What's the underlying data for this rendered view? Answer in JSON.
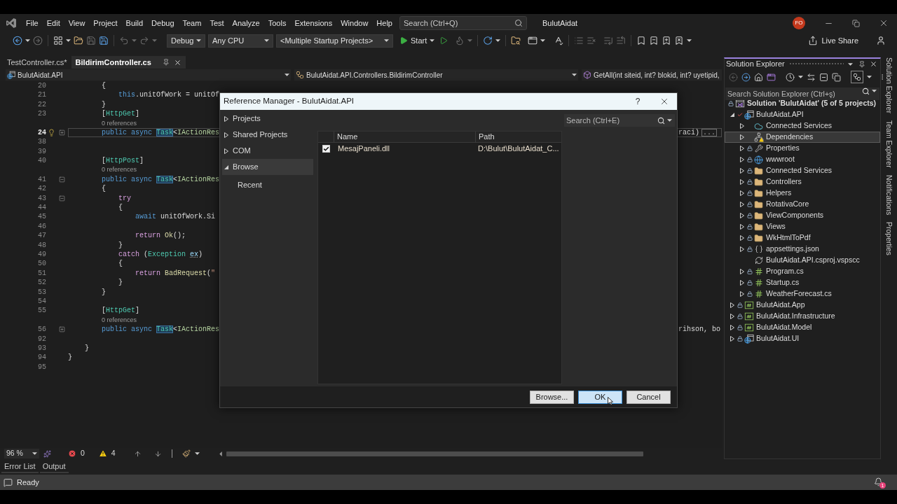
{
  "menu_bar": {
    "items": [
      "File",
      "Edit",
      "View",
      "Project",
      "Build",
      "Debug",
      "Team",
      "Test",
      "Analyze",
      "Tools",
      "Extensions",
      "Window",
      "Help"
    ],
    "search": {
      "placeholder": "Search (Ctrl+Q)"
    },
    "solution_title": "BulutAidat",
    "account_initials": "FO"
  },
  "toolbar": {
    "configuration": "Debug",
    "platform": "Any CPU",
    "startup_projects": "<Multiple Startup Projects>",
    "start": "Start",
    "live_share": "Live Share"
  },
  "editor": {
    "tabs": [
      {
        "label": "TestController.cs*",
        "selected": false
      },
      {
        "label": "BildirimController.cs",
        "selected": true
      }
    ],
    "navigation": {
      "project": "BulutAidat.API",
      "type": "BulutAidat.API.Controllers.BildirimController",
      "member": "GetAll(int siteid, int? blokid, int? uyetipid,"
    },
    "lines": [
      {
        "kind": "code",
        "number": "20",
        "current": false,
        "lightbulb": false,
        "tokens": [
          {
            "kind": "plain",
            "text": "        {"
          }
        ]
      },
      {
        "kind": "code",
        "number": "21",
        "current": false,
        "lightbulb": false,
        "tokens": [
          {
            "kind": "keyword",
            "text": "            this"
          },
          {
            "kind": "plain",
            "text": ".unitOfWork = unitOf"
          }
        ]
      },
      {
        "kind": "code",
        "number": "22",
        "current": false,
        "lightbulb": false,
        "tokens": [
          {
            "kind": "plain",
            "text": "        }"
          }
        ]
      },
      {
        "kind": "code",
        "number": "23",
        "current": false,
        "lightbulb": false,
        "tokens": [
          {
            "kind": "plain",
            "text": "        ["
          },
          {
            "kind": "type",
            "text": "HttpGet"
          },
          {
            "kind": "plain",
            "text": "]"
          }
        ]
      },
      {
        "kind": "codelens",
        "text": "0 references"
      },
      {
        "kind": "code",
        "number": "24",
        "current": true,
        "lightbulb": true,
        "collapsed": true,
        "tokens": [
          {
            "kind": "keyword",
            "text": "        public async "
          },
          {
            "kind": "type-highlighted",
            "text": "Task"
          },
          {
            "kind": "plain",
            "text": "<"
          },
          {
            "kind": "interface",
            "text": "IActionRes"
          }
        ],
        "tail": "raci)",
        "collapsed_marker": "..."
      },
      {
        "kind": "code",
        "number": "38",
        "current": false,
        "lightbulb": false
      },
      {
        "kind": "code",
        "number": "39",
        "current": false,
        "lightbulb": false
      },
      {
        "kind": "code",
        "number": "40",
        "current": false,
        "lightbulb": false,
        "tokens": [
          {
            "kind": "plain",
            "text": "        ["
          },
          {
            "kind": "type",
            "text": "HttpPost"
          },
          {
            "kind": "plain",
            "text": "]"
          }
        ]
      },
      {
        "kind": "codelens",
        "text": "0 references"
      },
      {
        "kind": "code",
        "number": "41",
        "current": false,
        "lightbulb": false,
        "collapsed": false,
        "tokens": [
          {
            "kind": "keyword",
            "text": "        public async "
          },
          {
            "kind": "type-highlighted",
            "text": "Task"
          },
          {
            "kind": "plain",
            "text": "<"
          },
          {
            "kind": "interface",
            "text": "IActionRes"
          }
        ]
      },
      {
        "kind": "code",
        "number": "42",
        "current": false,
        "lightbulb": false,
        "tokens": [
          {
            "kind": "plain",
            "text": "        {"
          }
        ]
      },
      {
        "kind": "code",
        "number": "43",
        "current": false,
        "lightbulb": false,
        "collapsed": false,
        "tokens": [
          {
            "kind": "control",
            "text": "            try"
          }
        ]
      },
      {
        "kind": "code",
        "number": "44",
        "current": false,
        "lightbulb": false,
        "tokens": [
          {
            "kind": "plain",
            "text": "            {"
          }
        ]
      },
      {
        "kind": "code",
        "number": "45",
        "current": false,
        "lightbulb": false,
        "tokens": [
          {
            "kind": "keyword",
            "text": "                await"
          },
          {
            "kind": "plain",
            "text": " unitOfWork.Si"
          }
        ]
      },
      {
        "kind": "code",
        "number": "46",
        "current": false,
        "lightbulb": false
      },
      {
        "kind": "code",
        "number": "47",
        "current": false,
        "lightbulb": false,
        "tokens": [
          {
            "kind": "control",
            "text": "                return "
          },
          {
            "kind": "method",
            "text": "Ok"
          },
          {
            "kind": "plain",
            "text": "();"
          }
        ]
      },
      {
        "kind": "code",
        "number": "48",
        "current": false,
        "lightbulb": false,
        "tokens": [
          {
            "kind": "plain",
            "text": "            }"
          }
        ]
      },
      {
        "kind": "code",
        "number": "49",
        "current": false,
        "lightbulb": false,
        "tokens": [
          {
            "kind": "control",
            "text": "            catch"
          },
          {
            "kind": "plain",
            "text": " ("
          },
          {
            "kind": "type",
            "text": "Exception "
          },
          {
            "kind": "hint",
            "text": "ex"
          },
          {
            "kind": "plain",
            "text": ")"
          }
        ]
      },
      {
        "kind": "code",
        "number": "50",
        "current": false,
        "lightbulb": false,
        "tokens": [
          {
            "kind": "plain",
            "text": "            {"
          }
        ]
      },
      {
        "kind": "code",
        "number": "51",
        "current": false,
        "lightbulb": false,
        "tokens": [
          {
            "kind": "control",
            "text": "                return "
          },
          {
            "kind": "method",
            "text": "BadRequest"
          },
          {
            "kind": "plain",
            "text": "("
          },
          {
            "kind": "string",
            "text": "\""
          }
        ]
      },
      {
        "kind": "code",
        "number": "52",
        "current": false,
        "lightbulb": false,
        "tokens": [
          {
            "kind": "plain",
            "text": "            }"
          }
        ]
      },
      {
        "kind": "code",
        "number": "53",
        "current": false,
        "lightbulb": false,
        "tokens": [
          {
            "kind": "plain",
            "text": "        }"
          }
        ]
      },
      {
        "kind": "code",
        "number": "54",
        "current": false,
        "lightbulb": false
      },
      {
        "kind": "code",
        "number": "55",
        "current": false,
        "lightbulb": false,
        "tokens": [
          {
            "kind": "plain",
            "text": "        ["
          },
          {
            "kind": "type",
            "text": "HttpGet"
          },
          {
            "kind": "plain",
            "text": "]"
          }
        ]
      },
      {
        "kind": "codelens",
        "text": "0 references"
      },
      {
        "kind": "code",
        "number": "56",
        "current": false,
        "lightbulb": false,
        "collapsed": true,
        "tokens": [
          {
            "kind": "keyword",
            "text": "        public async "
          },
          {
            "kind": "type-highlighted",
            "text": "Task"
          },
          {
            "kind": "plain",
            "text": "<"
          },
          {
            "kind": "interface",
            "text": "IActionRes"
          }
        ],
        "tail": "rihson, bo"
      },
      {
        "kind": "code",
        "number": "92",
        "current": false,
        "lightbulb": false
      },
      {
        "kind": "code",
        "number": "93",
        "current": false,
        "lightbulb": false,
        "tokens": [
          {
            "kind": "plain",
            "text": "    }"
          }
        ]
      },
      {
        "kind": "code",
        "number": "94",
        "current": false,
        "lightbulb": false,
        "tokens": [
          {
            "kind": "plain",
            "text": "}"
          }
        ]
      },
      {
        "kind": "code",
        "number": "95",
        "current": false,
        "lightbulb": false
      }
    ],
    "status": {
      "zoom": "96 %",
      "errors": "0",
      "warnings": "4"
    }
  },
  "reference_manager": {
    "title": "Reference Manager - BulutAidat.API",
    "help": "?",
    "nav": [
      {
        "label": "Projects",
        "expanded": false,
        "selected": false
      },
      {
        "label": "Shared Projects",
        "expanded": false,
        "selected": false
      },
      {
        "label": "COM",
        "expanded": false,
        "selected": false
      },
      {
        "label": "Browse",
        "expanded": true,
        "selected": true,
        "children": [
          {
            "label": "Recent",
            "selected": false
          }
        ]
      }
    ],
    "search": {
      "placeholder": "Search (Ctrl+E)"
    },
    "columns": [
      "Name",
      "Path"
    ],
    "rows": [
      {
        "checked": true,
        "name": "MesajPaneli.dll",
        "path": "D:\\Bulut\\BulutAidat_C..."
      }
    ],
    "buttons": [
      {
        "label": "Browse...",
        "focused": false
      },
      {
        "label": "OK",
        "focused": true
      },
      {
        "label": "Cancel",
        "focused": false
      }
    ]
  },
  "solution_explorer": {
    "title": "Solution Explorer",
    "search": {
      "placeholder": "Search Solution Explorer (Ctrl+ş)"
    },
    "tree": [
      {
        "label": "Solution 'BulutAidat' (5 of 5 projects)",
        "kind": "solution",
        "locked": true,
        "checked_out": false,
        "selected": false,
        "children": [
          {
            "label": "BulutAidat.API",
            "kind": "web-project",
            "locked": false,
            "checked_out": true,
            "selected": false,
            "expanded": true,
            "children": [
              {
                "label": "Connected Services",
                "kind": "connected-services",
                "locked": false,
                "checked_out": false,
                "selected": false,
                "expanded": false
              },
              {
                "label": "Dependencies",
                "kind": "dependencies",
                "locked": false,
                "checked_out": false,
                "selected": true,
                "expanded": false
              },
              {
                "label": "Properties",
                "kind": "properties",
                "locked": true,
                "checked_out": false,
                "selected": false,
                "expanded": false
              },
              {
                "label": "wwwroot",
                "kind": "web-folder",
                "locked": true,
                "checked_out": false,
                "selected": false,
                "expanded": false
              },
              {
                "label": "Connected Services",
                "kind": "folder",
                "locked": true,
                "checked_out": false,
                "selected": false,
                "expanded": false
              },
              {
                "label": "Controllers",
                "kind": "folder",
                "locked": true,
                "checked_out": false,
                "selected": false,
                "expanded": false
              },
              {
                "label": "Helpers",
                "kind": "folder",
                "locked": true,
                "checked_out": false,
                "selected": false,
                "expanded": false
              },
              {
                "label": "RotativaCore",
                "kind": "folder",
                "locked": true,
                "checked_out": false,
                "selected": false,
                "expanded": false
              },
              {
                "label": "ViewComponents",
                "kind": "folder",
                "locked": true,
                "checked_out": false,
                "selected": false,
                "expanded": false
              },
              {
                "label": "Views",
                "kind": "folder",
                "locked": true,
                "checked_out": false,
                "selected": false,
                "expanded": false
              },
              {
                "label": "WkHtmlToPdf",
                "kind": "folder",
                "locked": true,
                "checked_out": false,
                "selected": false,
                "expanded": false
              },
              {
                "label": "appsettings.json",
                "kind": "json",
                "locked": true,
                "checked_out": false,
                "selected": false,
                "expanded": false
              },
              {
                "label": "BulutAidat.API.csproj.vspscc",
                "kind": "sync-file",
                "locked": false,
                "checked_out": false,
                "selected": false
              },
              {
                "label": "Program.cs",
                "kind": "csharp",
                "locked": true,
                "checked_out": false,
                "selected": false,
                "expanded": false
              },
              {
                "label": "Startup.cs",
                "kind": "csharp",
                "locked": true,
                "checked_out": false,
                "selected": false,
                "expanded": false
              },
              {
                "label": "WeatherForecast.cs",
                "kind": "csharp",
                "locked": true,
                "checked_out": false,
                "selected": false,
                "expanded": false
              }
            ]
          },
          {
            "label": "BulutAidat.App",
            "kind": "csharp-project",
            "locked": true,
            "checked_out": false,
            "selected": false,
            "expanded": false
          },
          {
            "label": "BulutAidat.Infrastructure",
            "kind": "csharp-project",
            "locked": true,
            "checked_out": false,
            "selected": false,
            "expanded": false
          },
          {
            "label": "BulutAidat.Model",
            "kind": "csharp-project",
            "locked": true,
            "checked_out": false,
            "selected": false,
            "expanded": false
          },
          {
            "label": "BulutAidat.UI",
            "kind": "web-project",
            "locked": true,
            "checked_out": false,
            "selected": false,
            "expanded": false
          }
        ]
      }
    ]
  },
  "side_tabs": [
    "Solution Explorer",
    "Team Explorer",
    "Notifications",
    "Properties"
  ],
  "tool_tabs": [
    "Error List",
    "Output"
  ],
  "status_bar": {
    "text": "Ready",
    "notifications": "1"
  }
}
